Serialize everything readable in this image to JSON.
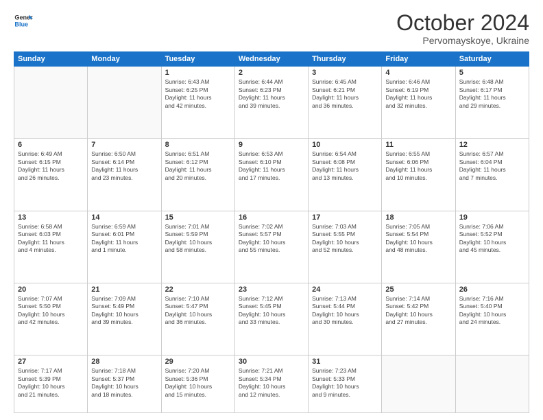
{
  "header": {
    "logo_line1": "General",
    "logo_line2": "Blue",
    "month": "October 2024",
    "location": "Pervomayskoye, Ukraine"
  },
  "weekdays": [
    "Sunday",
    "Monday",
    "Tuesday",
    "Wednesday",
    "Thursday",
    "Friday",
    "Saturday"
  ],
  "weeks": [
    [
      {
        "day": "",
        "info": ""
      },
      {
        "day": "",
        "info": ""
      },
      {
        "day": "1",
        "info": "Sunrise: 6:43 AM\nSunset: 6:25 PM\nDaylight: 11 hours\nand 42 minutes."
      },
      {
        "day": "2",
        "info": "Sunrise: 6:44 AM\nSunset: 6:23 PM\nDaylight: 11 hours\nand 39 minutes."
      },
      {
        "day": "3",
        "info": "Sunrise: 6:45 AM\nSunset: 6:21 PM\nDaylight: 11 hours\nand 36 minutes."
      },
      {
        "day": "4",
        "info": "Sunrise: 6:46 AM\nSunset: 6:19 PM\nDaylight: 11 hours\nand 32 minutes."
      },
      {
        "day": "5",
        "info": "Sunrise: 6:48 AM\nSunset: 6:17 PM\nDaylight: 11 hours\nand 29 minutes."
      }
    ],
    [
      {
        "day": "6",
        "info": "Sunrise: 6:49 AM\nSunset: 6:15 PM\nDaylight: 11 hours\nand 26 minutes."
      },
      {
        "day": "7",
        "info": "Sunrise: 6:50 AM\nSunset: 6:14 PM\nDaylight: 11 hours\nand 23 minutes."
      },
      {
        "day": "8",
        "info": "Sunrise: 6:51 AM\nSunset: 6:12 PM\nDaylight: 11 hours\nand 20 minutes."
      },
      {
        "day": "9",
        "info": "Sunrise: 6:53 AM\nSunset: 6:10 PM\nDaylight: 11 hours\nand 17 minutes."
      },
      {
        "day": "10",
        "info": "Sunrise: 6:54 AM\nSunset: 6:08 PM\nDaylight: 11 hours\nand 13 minutes."
      },
      {
        "day": "11",
        "info": "Sunrise: 6:55 AM\nSunset: 6:06 PM\nDaylight: 11 hours\nand 10 minutes."
      },
      {
        "day": "12",
        "info": "Sunrise: 6:57 AM\nSunset: 6:04 PM\nDaylight: 11 hours\nand 7 minutes."
      }
    ],
    [
      {
        "day": "13",
        "info": "Sunrise: 6:58 AM\nSunset: 6:03 PM\nDaylight: 11 hours\nand 4 minutes."
      },
      {
        "day": "14",
        "info": "Sunrise: 6:59 AM\nSunset: 6:01 PM\nDaylight: 11 hours\nand 1 minute."
      },
      {
        "day": "15",
        "info": "Sunrise: 7:01 AM\nSunset: 5:59 PM\nDaylight: 10 hours\nand 58 minutes."
      },
      {
        "day": "16",
        "info": "Sunrise: 7:02 AM\nSunset: 5:57 PM\nDaylight: 10 hours\nand 55 minutes."
      },
      {
        "day": "17",
        "info": "Sunrise: 7:03 AM\nSunset: 5:55 PM\nDaylight: 10 hours\nand 52 minutes."
      },
      {
        "day": "18",
        "info": "Sunrise: 7:05 AM\nSunset: 5:54 PM\nDaylight: 10 hours\nand 48 minutes."
      },
      {
        "day": "19",
        "info": "Sunrise: 7:06 AM\nSunset: 5:52 PM\nDaylight: 10 hours\nand 45 minutes."
      }
    ],
    [
      {
        "day": "20",
        "info": "Sunrise: 7:07 AM\nSunset: 5:50 PM\nDaylight: 10 hours\nand 42 minutes."
      },
      {
        "day": "21",
        "info": "Sunrise: 7:09 AM\nSunset: 5:49 PM\nDaylight: 10 hours\nand 39 minutes."
      },
      {
        "day": "22",
        "info": "Sunrise: 7:10 AM\nSunset: 5:47 PM\nDaylight: 10 hours\nand 36 minutes."
      },
      {
        "day": "23",
        "info": "Sunrise: 7:12 AM\nSunset: 5:45 PM\nDaylight: 10 hours\nand 33 minutes."
      },
      {
        "day": "24",
        "info": "Sunrise: 7:13 AM\nSunset: 5:44 PM\nDaylight: 10 hours\nand 30 minutes."
      },
      {
        "day": "25",
        "info": "Sunrise: 7:14 AM\nSunset: 5:42 PM\nDaylight: 10 hours\nand 27 minutes."
      },
      {
        "day": "26",
        "info": "Sunrise: 7:16 AM\nSunset: 5:40 PM\nDaylight: 10 hours\nand 24 minutes."
      }
    ],
    [
      {
        "day": "27",
        "info": "Sunrise: 7:17 AM\nSunset: 5:39 PM\nDaylight: 10 hours\nand 21 minutes."
      },
      {
        "day": "28",
        "info": "Sunrise: 7:18 AM\nSunset: 5:37 PM\nDaylight: 10 hours\nand 18 minutes."
      },
      {
        "day": "29",
        "info": "Sunrise: 7:20 AM\nSunset: 5:36 PM\nDaylight: 10 hours\nand 15 minutes."
      },
      {
        "day": "30",
        "info": "Sunrise: 7:21 AM\nSunset: 5:34 PM\nDaylight: 10 hours\nand 12 minutes."
      },
      {
        "day": "31",
        "info": "Sunrise: 7:23 AM\nSunset: 5:33 PM\nDaylight: 10 hours\nand 9 minutes."
      },
      {
        "day": "",
        "info": ""
      },
      {
        "day": "",
        "info": ""
      }
    ]
  ]
}
